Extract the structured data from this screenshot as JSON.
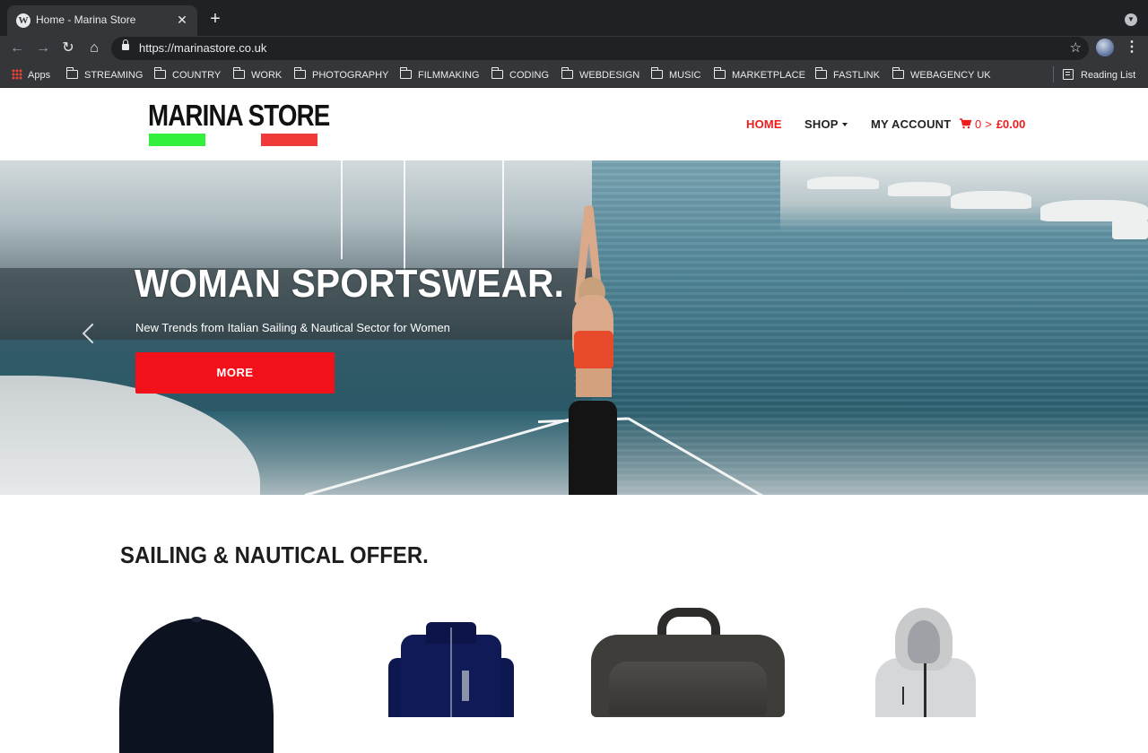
{
  "browser": {
    "tab_title": "Home - Marina Store",
    "tab_favicon": "W",
    "close_glyph": "✕",
    "new_tab_glyph": "+",
    "url": "https://marinastore.co.uk",
    "back_glyph": "←",
    "forward_glyph": "→",
    "reload_glyph": "↻",
    "home_glyph": "⌂",
    "star_glyph": "☆",
    "menu_glyph": "⋮",
    "tab_menu_glyph": "▼"
  },
  "bookmarks": {
    "apps": "Apps",
    "items": [
      "STREAMING",
      "COUNTRY",
      "WORK",
      "PHOTOGRAPHY",
      "FILMMAKING",
      "CODING",
      "WEBDESIGN",
      "MUSIC",
      "MARKETPLACE",
      "FASTLINK",
      "WEBAGENCY UK"
    ],
    "reading_list": "Reading List"
  },
  "site": {
    "logo_text": "MARINA STORE",
    "logo_colors": {
      "green": "#32f03c",
      "red": "#f03a3a"
    },
    "nav": {
      "home": "HOME",
      "shop": "SHOP",
      "account": "MY ACCOUNT"
    },
    "cart": {
      "count": "0",
      "arrow": ">",
      "total": "£0.00"
    },
    "accent_color": "#f01c1c"
  },
  "hero": {
    "title": "WOMAN SPORTSWEAR.",
    "subtitle": "New Trends from Italian Sailing & Nautical Sector for Women",
    "button": "MORE",
    "button_color": "#f2101a"
  },
  "section": {
    "title": "SAILING & NAUTICAL OFFER."
  },
  "products": [
    "cap",
    "fleece-jacket",
    "bag",
    "softshell-hoodie"
  ]
}
